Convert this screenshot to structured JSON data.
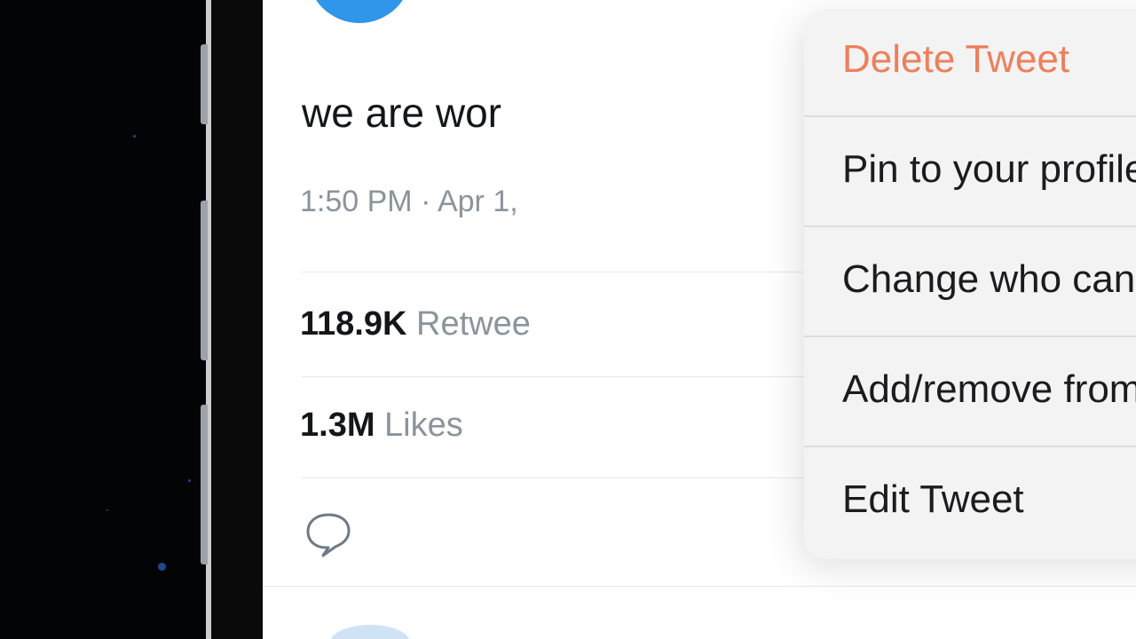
{
  "tweet": {
    "text": "we are wor",
    "timestamp": "1:50 PM · Apr 1,",
    "retweets_count": "118.9K",
    "retweets_label": "Retwee",
    "likes_count": "1.3M",
    "likes_label": "Likes"
  },
  "menu": {
    "items": [
      {
        "label": "Delete Tweet",
        "icon": "trash-icon"
      },
      {
        "label": "Pin to your profile",
        "icon": "pin-icon"
      },
      {
        "label": "Change who can reply",
        "icon": "speech-bubble-icon"
      },
      {
        "label": "Add/remove from Lists",
        "icon": "list-add-icon"
      },
      {
        "label": "Edit Tweet",
        "icon": "pencil-icon"
      }
    ]
  },
  "colors": {
    "destructive": "#ee7f5c",
    "avatar": "#2f96ea",
    "secondary_text": "#8a949d"
  }
}
